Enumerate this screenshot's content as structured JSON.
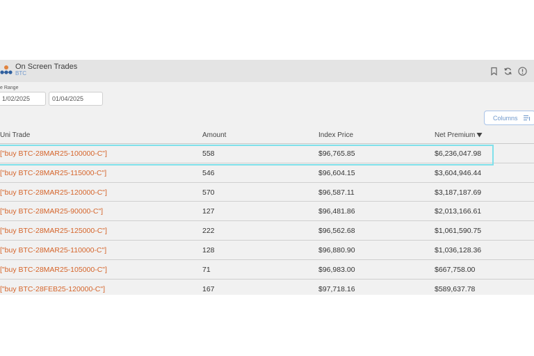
{
  "app": {
    "title": "On Screen Trades",
    "subtitle": "BTC"
  },
  "filters": {
    "range_label": "e Range",
    "start_date": "1/02/2025",
    "end_date": "01/04/2025"
  },
  "toolbar": {
    "columns_label": "Columns"
  },
  "table": {
    "headers": [
      "Uni Trade",
      "Amount",
      "Index Price",
      "Net Premium"
    ],
    "sort_column": "Net Premium",
    "sort_direction": "desc",
    "rows": [
      {
        "trade": "[\"buy BTC-28MAR25-100000-C\"]",
        "amount": "558",
        "index_price": "$96,765.85",
        "net_premium": "$6,236,047.98"
      },
      {
        "trade": "[\"buy BTC-28MAR25-115000-C\"]",
        "amount": "546",
        "index_price": "$96,604.15",
        "net_premium": "$3,604,946.44"
      },
      {
        "trade": "[\"buy BTC-28MAR25-120000-C\"]",
        "amount": "570",
        "index_price": "$96,587.11",
        "net_premium": "$3,187,187.69"
      },
      {
        "trade": "[\"buy BTC-28MAR25-90000-C\"]",
        "amount": "127",
        "index_price": "$96,481.86",
        "net_premium": "$2,013,166.61"
      },
      {
        "trade": "[\"buy BTC-28MAR25-125000-C\"]",
        "amount": "222",
        "index_price": "$96,562.68",
        "net_premium": "$1,061,590.75"
      },
      {
        "trade": "[\"buy BTC-28MAR25-110000-C\"]",
        "amount": "128",
        "index_price": "$96,880.90",
        "net_premium": "$1,036,128.36"
      },
      {
        "trade": "[\"buy BTC-28MAR25-105000-C\"]",
        "amount": "71",
        "index_price": "$96,983.00",
        "net_premium": "$667,758.00"
      },
      {
        "trade": "[\"buy BTC-28FEB25-120000-C\"]",
        "amount": "167",
        "index_price": "$97,718.16",
        "net_premium": "$589,637.78"
      }
    ]
  },
  "colors": {
    "accent": "#6f98cc",
    "trade_link": "#d5642a",
    "highlight": "#7fe0ea",
    "header_bg": "#e4e4e4",
    "panel_bg": "#f1f1f1"
  },
  "icons": [
    "app-logo-icon",
    "bookmark-icon",
    "refresh-icon",
    "info-icon",
    "columns-icon",
    "sort-desc-icon"
  ]
}
